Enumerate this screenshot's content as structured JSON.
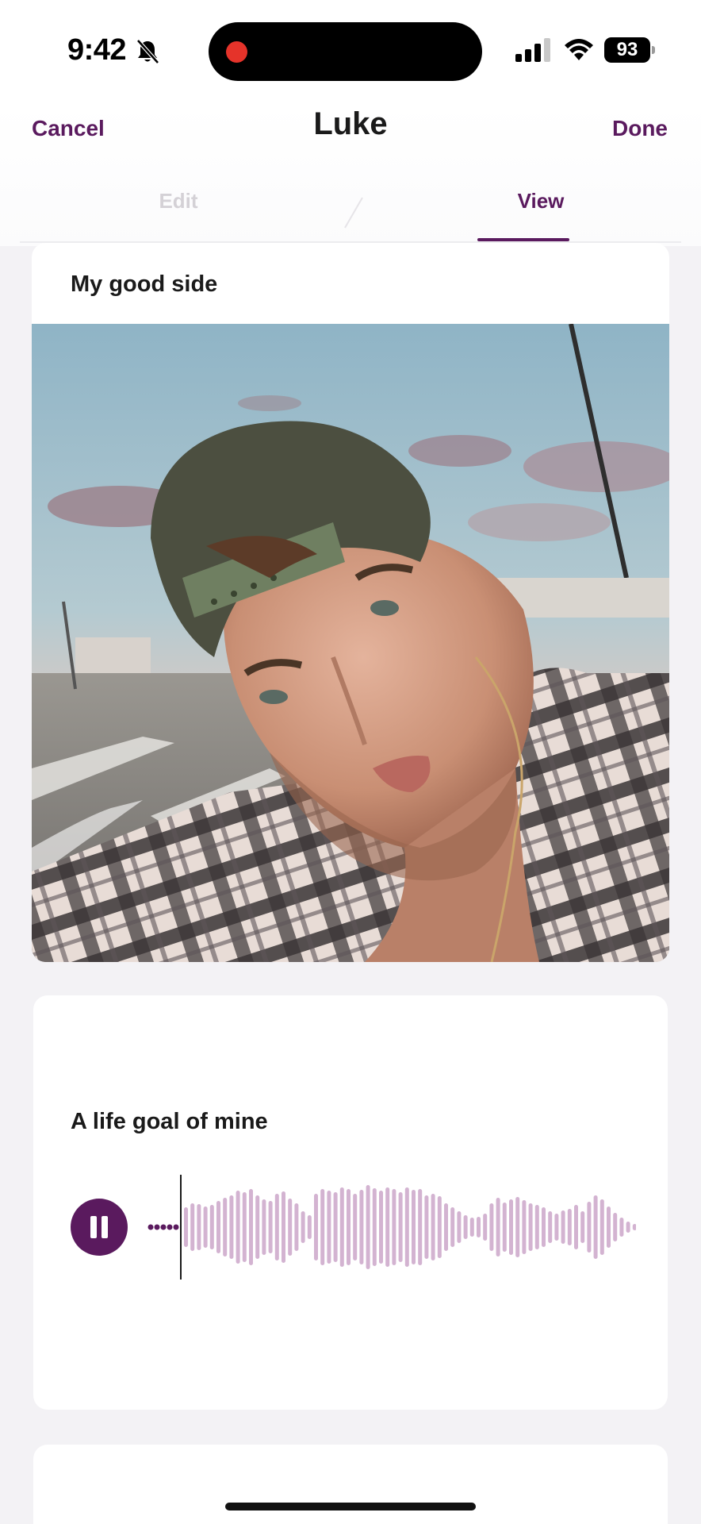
{
  "status_bar": {
    "time": "9:42",
    "battery": "93",
    "icons": [
      "bell-off-icon",
      "record-dot-icon",
      "signal-icon",
      "wifi-icon",
      "battery-icon"
    ]
  },
  "header": {
    "cancel_label": "Cancel",
    "title": "Luke",
    "done_label": "Done"
  },
  "tabs": [
    {
      "label": "Edit",
      "active": false
    },
    {
      "label": "View",
      "active": true
    }
  ],
  "photo_card": {
    "prompt": "My good side"
  },
  "voice_card": {
    "prompt": "A life goal of mine",
    "state": "playing",
    "progress": 0.04
  },
  "colors": {
    "accent": "#5a1a5e",
    "waveform": "#d3b3d1",
    "tab_inactive": "#d4d1d6",
    "background": "#f3f2f5"
  }
}
